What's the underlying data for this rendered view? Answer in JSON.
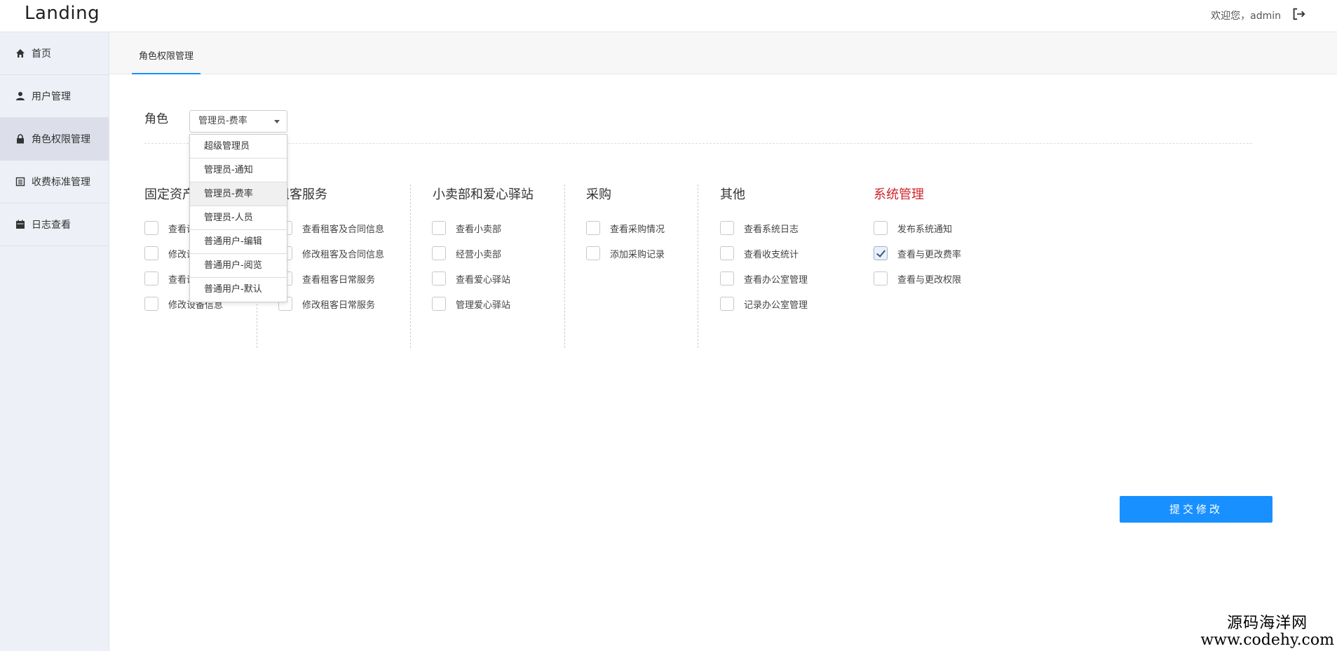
{
  "header": {
    "logo": "Landing",
    "welcome": "欢迎您，admin",
    "logout_icon": "logout-icon"
  },
  "sidebar": {
    "items": [
      {
        "label": "首页",
        "icon": "home-icon"
      },
      {
        "label": "用户管理",
        "icon": "user-icon"
      },
      {
        "label": "角色权限管理",
        "icon": "lock-icon"
      },
      {
        "label": "收费标准管理",
        "icon": "list-icon"
      },
      {
        "label": "日志查看",
        "icon": "calendar-icon"
      }
    ]
  },
  "tabs": [
    {
      "label": "角色权限管理"
    }
  ],
  "role": {
    "label": "角色",
    "selected": "管理员-费率",
    "options": [
      "超级管理员",
      "管理员-通知",
      "管理员-费率",
      "管理员-人员",
      "普通用户-编辑",
      "普通用户-阅览",
      "普通用户-默认"
    ]
  },
  "groups": [
    {
      "title": "固定资产",
      "items": [
        {
          "label": "查看设备信息",
          "checked": false
        },
        {
          "label": "修改设备信息",
          "checked": false
        },
        {
          "label": "查看设备信息",
          "checked": false
        },
        {
          "label": "修改设备信息",
          "checked": false
        }
      ]
    },
    {
      "title": "租客服务",
      "items": [
        {
          "label": "查看租客及合同信息",
          "checked": false
        },
        {
          "label": "修改租客及合同信息",
          "checked": false
        },
        {
          "label": "查看租客日常服务",
          "checked": false
        },
        {
          "label": "修改租客日常服务",
          "checked": false
        }
      ]
    },
    {
      "title": "小卖部和爱心驿站",
      "items": [
        {
          "label": "查看小卖部",
          "checked": false
        },
        {
          "label": "经营小卖部",
          "checked": false
        },
        {
          "label": "查看爱心驿站",
          "checked": false
        },
        {
          "label": "管理爱心驿站",
          "checked": false
        }
      ]
    },
    {
      "title": "采购",
      "items": [
        {
          "label": "查看采购情况",
          "checked": false
        },
        {
          "label": "添加采购记录",
          "checked": false
        }
      ]
    },
    {
      "title": "其他",
      "items": [
        {
          "label": "查看系统日志",
          "checked": false
        },
        {
          "label": "查看收支统计",
          "checked": false
        },
        {
          "label": "查看办公室管理",
          "checked": false
        },
        {
          "label": "记录办公室管理",
          "checked": false
        }
      ]
    },
    {
      "title": "系统管理",
      "title_color": "#d0232a",
      "items": [
        {
          "label": "发布系统通知",
          "checked": false
        },
        {
          "label": "查看与更改费率",
          "checked": true
        },
        {
          "label": "查看与更改权限",
          "checked": false
        }
      ]
    }
  ],
  "submit_label": "提交修改",
  "watermark": {
    "line1": "源码海洋网",
    "line2": "www.codehy.com"
  }
}
